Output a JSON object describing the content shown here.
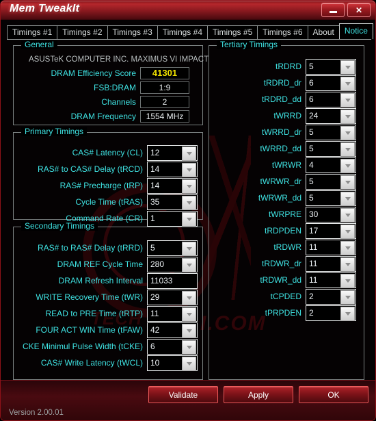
{
  "window": {
    "title": "Mem TweakIt",
    "minimize_label": "minimize",
    "close_label": "✕"
  },
  "tabs": [
    {
      "label": "Timings #1",
      "active": false
    },
    {
      "label": "Timings #2",
      "active": false
    },
    {
      "label": "Timings #3",
      "active": false
    },
    {
      "label": "Timings #4",
      "active": false
    },
    {
      "label": "Timings #5",
      "active": false
    },
    {
      "label": "Timings #6",
      "active": false
    },
    {
      "label": "About",
      "active": false
    },
    {
      "label": "Notice",
      "active": true
    }
  ],
  "general": {
    "title": "General",
    "oem": "ASUSTeK COMPUTER INC. MAXIMUS VI IMPACT",
    "rows": [
      {
        "label": "DRAM Efficiency Score",
        "value": "41301",
        "accent": "#f2e400"
      },
      {
        "label": "FSB:DRAM",
        "value": "1:9"
      },
      {
        "label": "Channels",
        "value": "2"
      },
      {
        "label": "DRAM Frequency",
        "value": "1554 MHz"
      }
    ]
  },
  "primary": {
    "title": "Primary Timings",
    "rows": [
      {
        "label": "CAS# Latency (CL)",
        "value": "12"
      },
      {
        "label": "RAS# to CAS# Delay (tRCD)",
        "value": "14"
      },
      {
        "label": "RAS# Precharge (tRP)",
        "value": "14"
      },
      {
        "label": "Cycle Time (tRAS)",
        "value": "35"
      },
      {
        "label": "Command Rate (CR)",
        "value": "1"
      }
    ]
  },
  "secondary": {
    "title": "Secondary Timings",
    "rows": [
      {
        "label": "RAS# to RAS# Delay (tRRD)",
        "value": "5",
        "spinner": true
      },
      {
        "label": "DRAM REF Cycle Time",
        "value": "280",
        "spinner": true
      },
      {
        "label": "DRAM Refresh Interval",
        "value": "11033",
        "spinner": false
      },
      {
        "label": "WRITE Recovery Time (tWR)",
        "value": "29",
        "spinner": true
      },
      {
        "label": "READ to PRE Time (tRTP)",
        "value": "11",
        "spinner": true
      },
      {
        "label": "FOUR ACT WIN Time (tFAW)",
        "value": "42",
        "spinner": true
      },
      {
        "label": "CKE Minimul Pulse Width (tCKE)",
        "value": "6",
        "spinner": true
      },
      {
        "label": "CAS# Write Latency (tWCL)",
        "value": "10",
        "spinner": true
      }
    ]
  },
  "tertiary": {
    "title": "Tertiary Timings",
    "rows": [
      {
        "label": "tRDRD",
        "value": "5"
      },
      {
        "label": "tRDRD_dr",
        "value": "6"
      },
      {
        "label": "tRDRD_dd",
        "value": "6"
      },
      {
        "label": "tWRRD",
        "value": "24"
      },
      {
        "label": "tWRRD_dr",
        "value": "5"
      },
      {
        "label": "tWRRD_dd",
        "value": "5"
      },
      {
        "label": "tWRWR",
        "value": "4"
      },
      {
        "label": "tWRWR_dr",
        "value": "5"
      },
      {
        "label": "tWRWR_dd",
        "value": "5"
      },
      {
        "label": "tWRPRE",
        "value": "30"
      },
      {
        "label": "tRDPDEN",
        "value": "17"
      },
      {
        "label": "tRDWR",
        "value": "11"
      },
      {
        "label": "tRDWR_dr",
        "value": "11"
      },
      {
        "label": "tRDWR_dd",
        "value": "11"
      },
      {
        "label": "tCPDED",
        "value": "2"
      },
      {
        "label": "tPRPDEN",
        "value": "2"
      }
    ]
  },
  "footer": {
    "buttons": [
      {
        "label": "Validate",
        "name": "validate-button"
      },
      {
        "label": "Apply",
        "name": "apply-button"
      },
      {
        "label": "OK",
        "name": "ok-button"
      }
    ],
    "version": "Version 2.00.01"
  },
  "watermark": {
    "tech_text": "TECH",
    "com_text": "I.COM"
  }
}
